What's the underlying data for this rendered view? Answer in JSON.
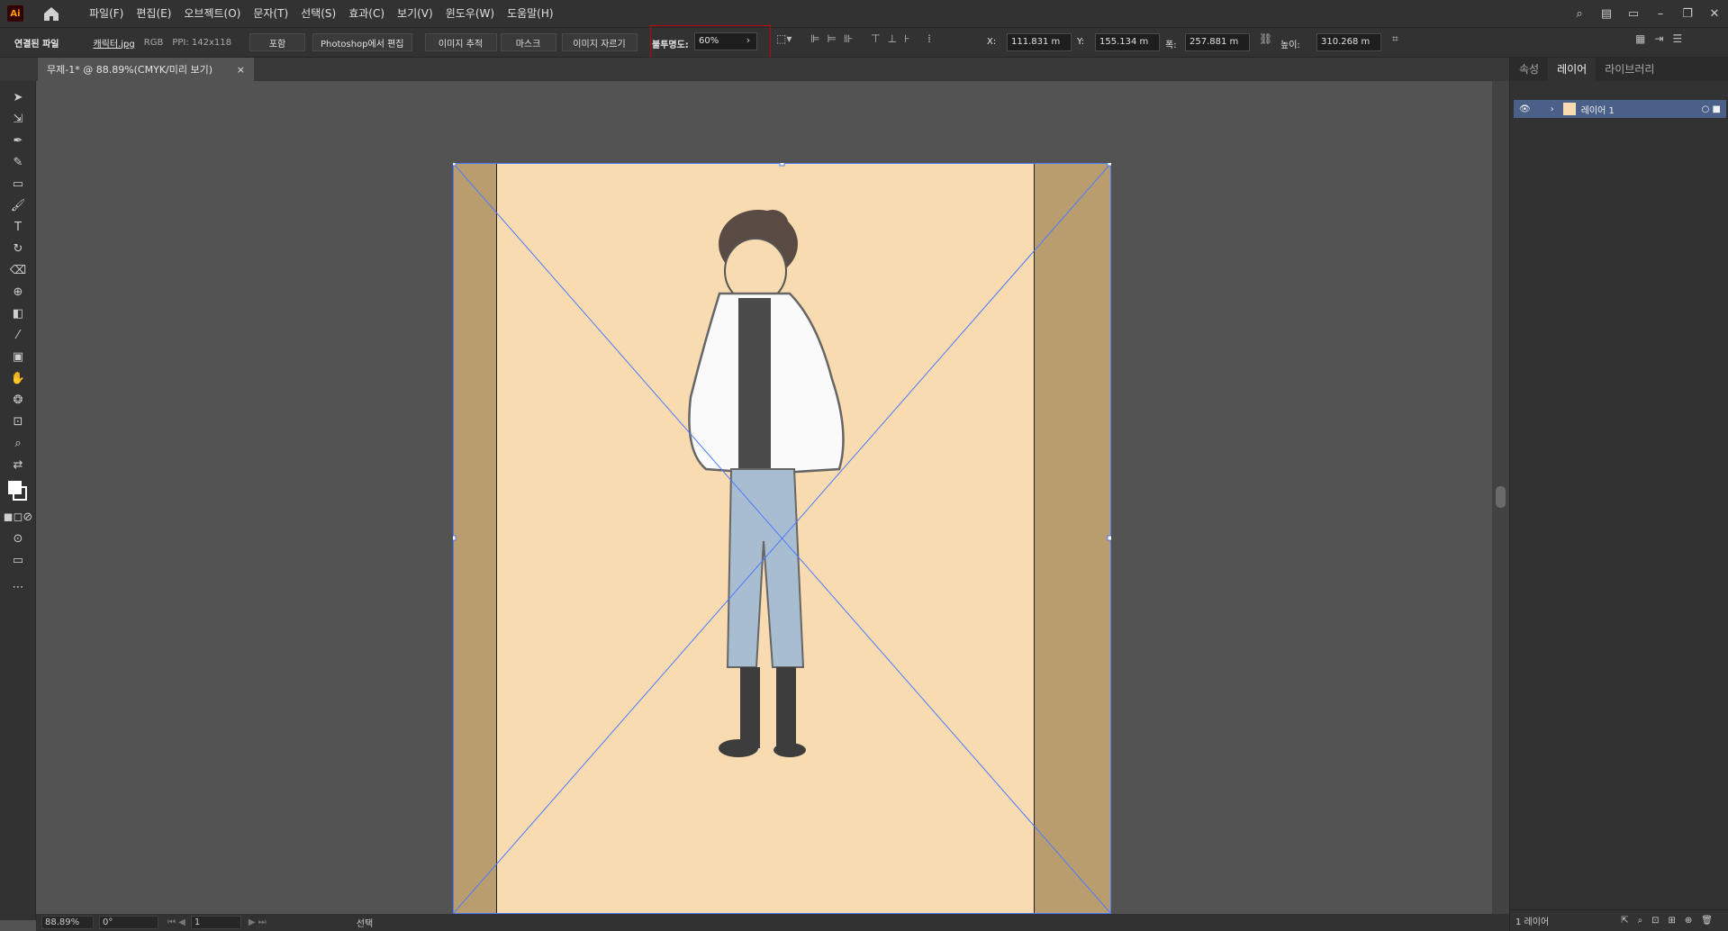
{
  "app": {
    "logo": "Ai"
  },
  "menu": [
    "파일(F)",
    "편집(E)",
    "오브젝트(O)",
    "문자(T)",
    "선택(S)",
    "효과(C)",
    "보기(V)",
    "윈도우(W)",
    "도움말(H)"
  ],
  "control": {
    "title": "연결된 파일",
    "filename": "캐릭터.jpg",
    "color_mode": "RGB",
    "ppi": "PPI: 142x118",
    "embed": "포함",
    "edit_ps": "Photoshop에서 편집",
    "trace": "이미지 추적",
    "mask": "마스크",
    "crop": "이미지 자르기",
    "opacity_label": "불투명도:",
    "opacity_value": "60%",
    "x_label": "X:",
    "x_value": "111.831 m",
    "y_label": "Y:",
    "y_value": "155.134 m",
    "w_label": "폭:",
    "w_value": "257.881 m",
    "h_label": "높이:",
    "h_value": "310.268 m"
  },
  "doc_tab": {
    "title": "무제-1* @ 88.89%(CMYK/미리 보기)",
    "close": "×"
  },
  "status": {
    "zoom": "88.89%",
    "rotate": "0°",
    "page": "1",
    "tool": "선택"
  },
  "panel": {
    "tabs": [
      "속성",
      "레이어",
      "라이브러리"
    ],
    "active_tab": "레이어",
    "layer_name": "레이어 1",
    "footer": "1 레이어"
  },
  "colors": {
    "accent": "#4a7aff",
    "highlight_box": "#c00000",
    "artboard_bg": "#f8dbb1",
    "side_bg": "#b99d6f"
  }
}
